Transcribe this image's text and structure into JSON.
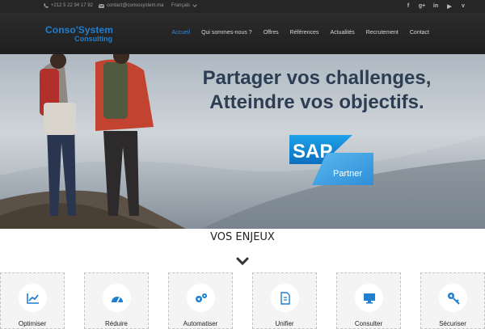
{
  "topbar": {
    "phone": "+212 5 22 94 17 92",
    "email": "contact@consosystem.ma",
    "language": "Français",
    "social": [
      {
        "icon": "facebook-icon",
        "glyph": "f"
      },
      {
        "icon": "google-plus-icon",
        "glyph": "g+"
      },
      {
        "icon": "linkedin-icon",
        "glyph": "in"
      },
      {
        "icon": "youtube-icon",
        "glyph": "▶"
      },
      {
        "icon": "vimeo-icon",
        "glyph": "v"
      }
    ]
  },
  "logo": {
    "line1": "Conso'System",
    "line2": "Consulting"
  },
  "nav": {
    "items": [
      {
        "label": "Accueil",
        "active": true
      },
      {
        "label": "Qui sommes-nous ?",
        "active": false
      },
      {
        "label": "Offres",
        "active": false
      },
      {
        "label": "Références",
        "active": false
      },
      {
        "label": "Actualités",
        "active": false
      },
      {
        "label": "Recrutement",
        "active": false
      },
      {
        "label": "Contact",
        "active": false
      }
    ]
  },
  "hero": {
    "line1": "Partager vos challenges,",
    "line2": "Atteindre vos objectifs.",
    "sap_logo": "SAP",
    "sap_badge": "Partner"
  },
  "section": {
    "title": "VOS ENJEUX"
  },
  "cards": [
    {
      "icon": "chart-line-icon",
      "label": "Optimiser"
    },
    {
      "icon": "gauge-icon",
      "label": "Réduire"
    },
    {
      "icon": "gears-icon",
      "label": "Automatiser"
    },
    {
      "icon": "document-icon",
      "label": "Unifier"
    },
    {
      "icon": "monitor-icon",
      "label": "Consulter"
    },
    {
      "icon": "key-icon",
      "label": "Sécuriser"
    }
  ],
  "colors": {
    "accent": "#2e8ce0",
    "topbar_bg": "#262626",
    "header_bg": "#232323",
    "hero_text": "#2d3e53",
    "sap_blue": "#1a8fd6",
    "partner_blue": "#4aa8e8"
  }
}
